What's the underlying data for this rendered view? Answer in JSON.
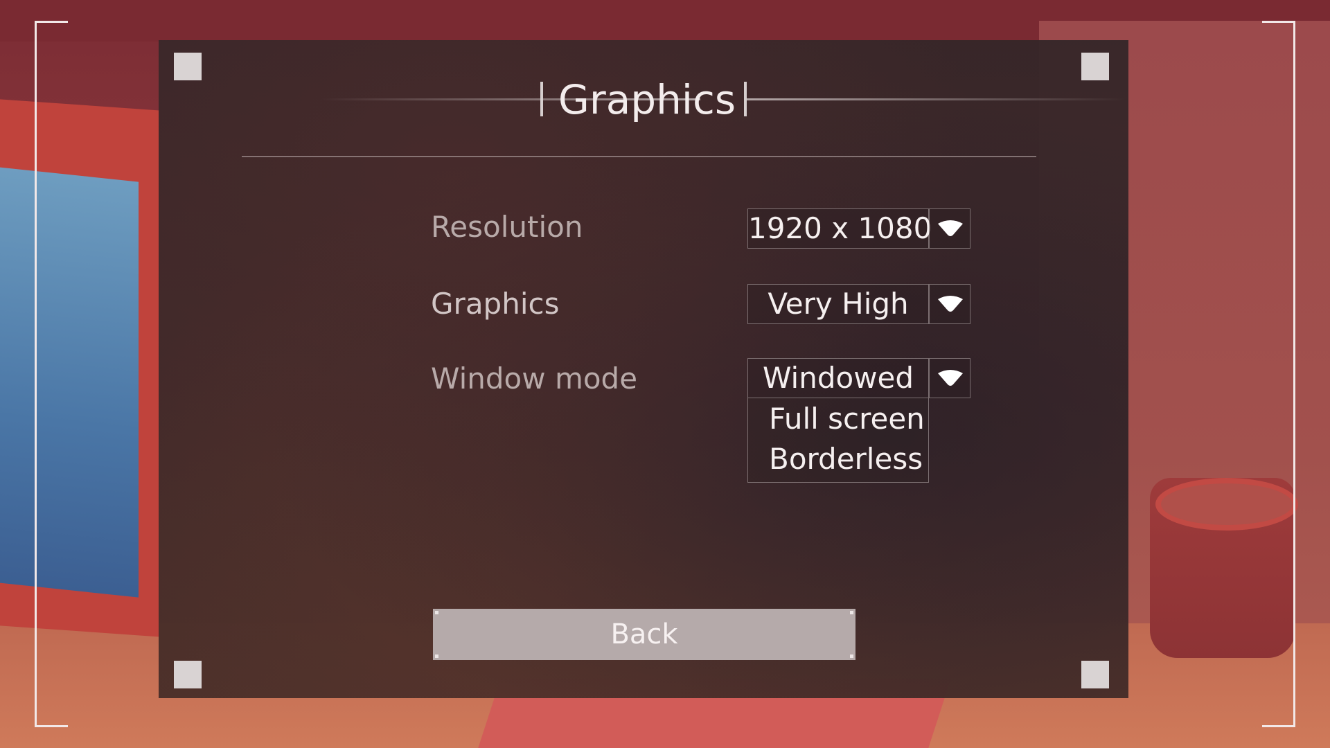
{
  "menu": {
    "title": "Graphics"
  },
  "settings": {
    "resolution": {
      "label": "Resolution",
      "value": "1920 x 1080"
    },
    "graphics": {
      "label": "Graphics",
      "value": "Very High"
    },
    "window_mode": {
      "label": "Window mode",
      "value": "Windowed",
      "options": [
        "Full screen",
        "Borderless"
      ],
      "expanded": true
    }
  },
  "back_button": {
    "label": "Back"
  },
  "icons": {
    "dropdown": "chevron-down-icon"
  }
}
